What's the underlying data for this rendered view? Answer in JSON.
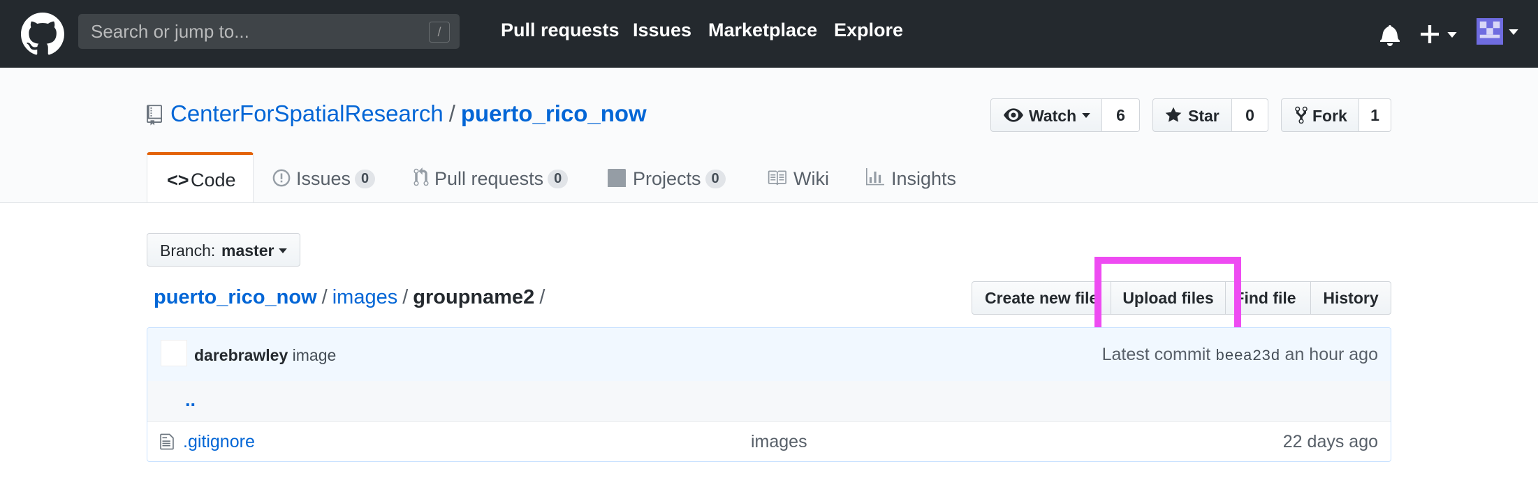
{
  "header": {
    "search_placeholder": "Search or jump to...",
    "search_shortcut": "/",
    "nav": [
      "Pull requests",
      "Issues",
      "Marketplace",
      "Explore"
    ]
  },
  "repo": {
    "owner": "CenterForSpatialResearch",
    "separator": "/",
    "name": "puerto_rico_now",
    "watch_label": "Watch",
    "watch_count": "6",
    "star_label": "Star",
    "star_count": "0",
    "fork_label": "Fork",
    "fork_count": "1"
  },
  "tabs": [
    {
      "label": "Code",
      "count": ""
    },
    {
      "label": "Issues",
      "count": "0"
    },
    {
      "label": "Pull requests",
      "count": "0"
    },
    {
      "label": "Projects",
      "count": "0"
    },
    {
      "label": "Wiki",
      "count": ""
    },
    {
      "label": "Insights",
      "count": ""
    }
  ],
  "branch": {
    "prefix": "Branch:",
    "name": "master"
  },
  "breadcrumb": {
    "root": "puerto_rico_now",
    "folder": "images",
    "current": "groupname2",
    "sep": "/"
  },
  "file_actions": {
    "create": "Create new file",
    "upload": "Upload files",
    "find": "Find file",
    "history": "History"
  },
  "commit": {
    "author": "darebrawley",
    "message": "image",
    "latest_label": "Latest commit",
    "sha": "beea23d",
    "time": "an hour ago"
  },
  "files": {
    "up_dir": "..",
    "rows": [
      {
        "name": ".gitignore",
        "message": "images",
        "age": "22 days ago"
      }
    ]
  },
  "colors": {
    "header_bg": "#24292e",
    "link": "#0366d6",
    "highlight": "#ee4bf2",
    "active_tab_border": "#e36209"
  }
}
